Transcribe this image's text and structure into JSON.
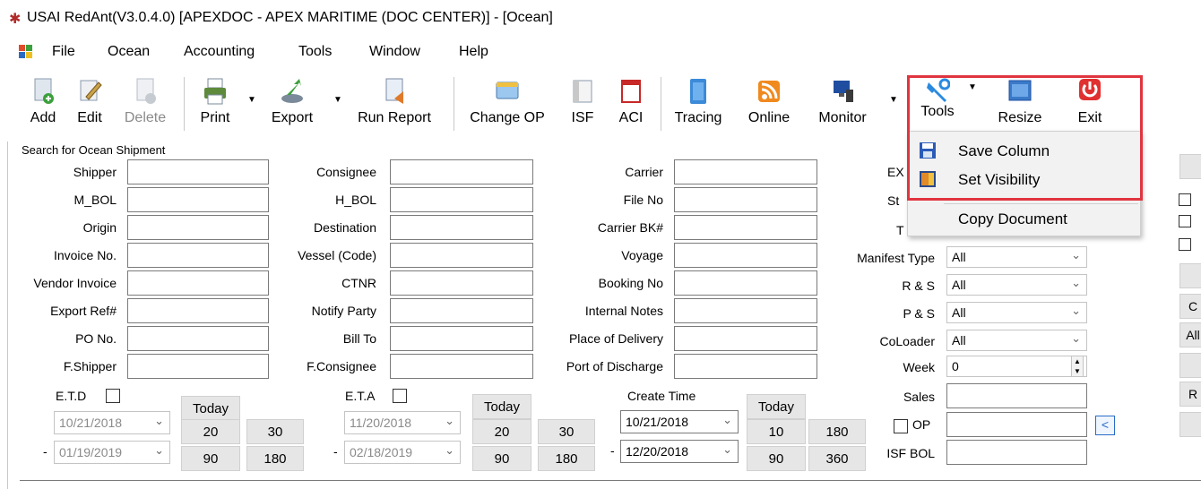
{
  "window": {
    "title": "USAI RedAnt(V3.0.4.0) [APEXDOC - APEX MARITIME (DOC CENTER)] - [Ocean]",
    "app_icon": "redant-icon"
  },
  "menu": {
    "items": [
      "File",
      "Ocean",
      "Accounting",
      "Tools",
      "Window",
      "Help"
    ]
  },
  "toolbar": {
    "add": "Add",
    "edit": "Edit",
    "delete": "Delete",
    "print": "Print",
    "export": "Export",
    "run_report": "Run Report",
    "change_op": "Change OP",
    "isf": "ISF",
    "aci": "ACI",
    "tracing": "Tracing",
    "online": "Online",
    "monitor": "Monitor",
    "tools": "Tools",
    "resize": "Resize",
    "exit": "Exit"
  },
  "tools_menu": {
    "save_column": "Save Column",
    "set_visibility": "Set Visibility",
    "copy_document": "Copy Document"
  },
  "search": {
    "group_title": "Search for Ocean Shipment",
    "col1": [
      "Shipper",
      "M_BOL",
      "Origin",
      "Invoice No.",
      "Vendor Invoice",
      "Export Ref#",
      "PO No.",
      "F.Shipper"
    ],
    "col2": [
      "Consignee",
      "H_BOL",
      "Destination",
      "Vessel (Code)",
      "CTNR",
      "Notify Party",
      "Bill To",
      "F.Consignee"
    ],
    "col3": [
      "Carrier",
      "File No",
      "Carrier BK#",
      "Voyage",
      "Booking No",
      "Internal Notes",
      "Place of Delivery",
      "Port of Discharge"
    ],
    "col4_partial": [
      "EX",
      "St",
      "T"
    ],
    "manifest_type": "Manifest Type",
    "r_s": "R & S",
    "p_s": "P & S",
    "coloader": "CoLoader",
    "week": "Week",
    "week_value": "0",
    "sales": "Sales",
    "op": "OP",
    "isf_bol": "ISF BOL",
    "all": "All",
    "op_button": "<"
  },
  "dates": {
    "etd_label": "E.T.D",
    "eta_label": "E.T.A",
    "create_time_label": "Create Time",
    "today": "Today",
    "dash": "-",
    "etd_from": "10/21/2018",
    "etd_to": "01/19/2019",
    "eta_from": "11/20/2018",
    "eta_to": "02/18/2019",
    "create_from": "10/21/2018",
    "create_to": "12/20/2018",
    "etd_btns": [
      "20",
      "30",
      "90",
      "180"
    ],
    "eta_btns": [
      "20",
      "30",
      "90",
      "180"
    ],
    "create_btns": [
      "10",
      "180",
      "90",
      "360"
    ]
  },
  "right_edge": {
    "labels": [
      "C",
      "All",
      "R"
    ]
  },
  "colors": {
    "highlight": "#e0353f",
    "accent_blue": "#2a6cc5"
  }
}
